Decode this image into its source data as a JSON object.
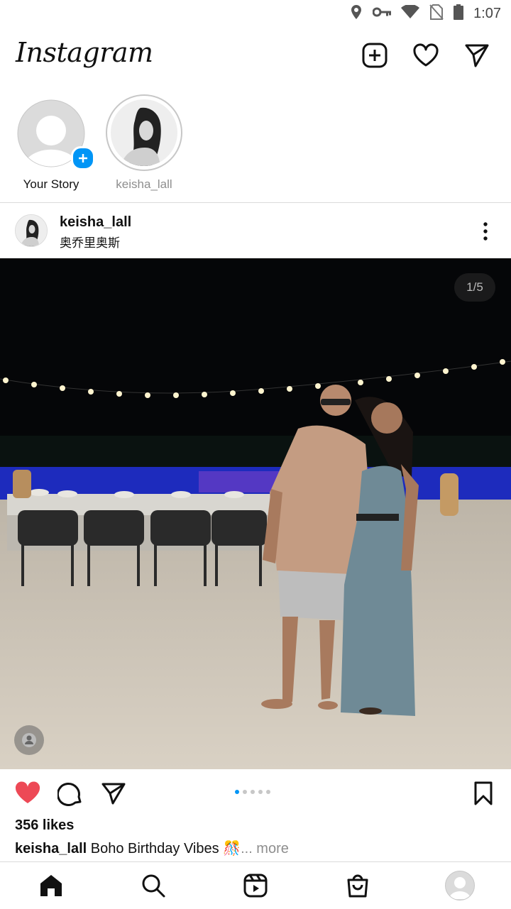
{
  "status_bar": {
    "time": "1:07",
    "icons": [
      "location-icon",
      "vpn-key-icon",
      "wifi-icon",
      "no-sim-icon",
      "battery-icon"
    ]
  },
  "header": {
    "logo": "Instagram",
    "actions": [
      "new-post-icon",
      "activity-heart-icon",
      "direct-message-icon"
    ]
  },
  "stories": [
    {
      "label": "Your Story",
      "muted": false
    },
    {
      "label": "keisha_lall",
      "muted": true
    }
  ],
  "post": {
    "username": "keisha_lall",
    "location": "奥乔里奥斯",
    "image_counter": "1/5",
    "likes": "356 likes",
    "caption_user": "keisha_lall",
    "caption_text": "Boho Birthday Vibes",
    "caption_emoji": "🎊",
    "more": "... more",
    "carousel_total": 5,
    "carousel_current": 1
  },
  "colors": {
    "like_red": "#ed4956",
    "accent_blue": "#0095f6",
    "divider": "#dbdbdb"
  },
  "bottom_nav": [
    "home-icon",
    "search-icon",
    "reels-icon",
    "shop-icon",
    "profile-avatar"
  ]
}
